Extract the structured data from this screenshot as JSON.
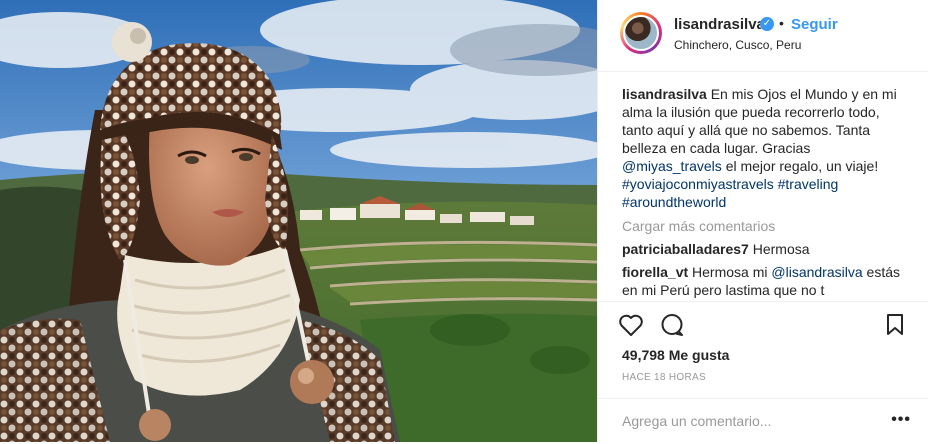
{
  "post": {
    "username": "lisandrasilva",
    "verified_icon": "verified-badge-icon",
    "separator": "•",
    "follow_label": "Seguir",
    "location": "Chinchero, Cusco, Peru"
  },
  "caption": {
    "username": "lisandrasilva",
    "text_1": "En mis Ojos el Mundo y en mi alma la ilusión que pueda recorrerlo todo, tanto aquí y allá que no sabemos. Tanta belleza en cada lugar. Gracias",
    "mention": "@miyas_travels",
    "text_2": "el mejor regalo, un viaje!",
    "hashtag_1": "#yoviajoconmiyastravels",
    "hashtag_2": "#traveling",
    "hashtag_3": "#aroundtheworld"
  },
  "load_more": "Cargar más comentarios",
  "comments": [
    {
      "username": "patriciaballadares7",
      "text": "Hermosa"
    },
    {
      "username": "fiorella_vt",
      "text_1": "Hermosa mi",
      "mention": "@lisandrasilva",
      "text_2": "estás en mi Perú pero lastima que no t"
    }
  ],
  "actions": {
    "like_icon": "heart-icon",
    "comment_icon": "comment-bubble-icon",
    "save_icon": "bookmark-icon"
  },
  "likes": "49,798 Me gusta",
  "time": "HACE 18 HORAS",
  "add_comment": {
    "placeholder": "Agrega un comentario...",
    "more_label": "•••"
  },
  "colors": {
    "link": "#003569",
    "follow": "#3897f0",
    "muted": "#999999",
    "divider": "#efefef"
  }
}
